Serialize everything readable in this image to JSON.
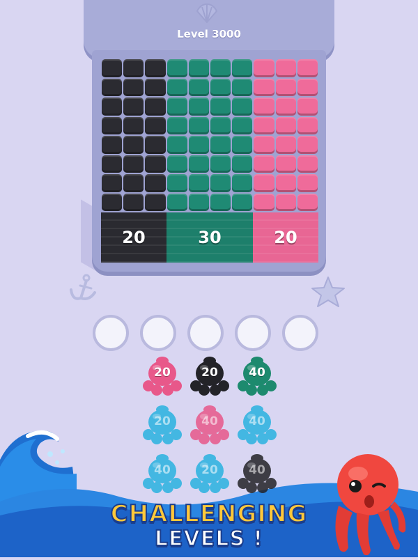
{
  "header": {
    "level_label": "Level 3000"
  },
  "board": {
    "columns": [
      {
        "color": "#2b2b31",
        "count": 3,
        "label": "20"
      },
      {
        "color": "#1f8a74",
        "count": 4,
        "label": "30"
      },
      {
        "color": "#ef6b9a",
        "count": 3,
        "label": "20"
      }
    ],
    "rows": 8
  },
  "slots": {
    "count": 5
  },
  "octopuses": [
    {
      "color": "#e8588a",
      "label": "20",
      "faded": false
    },
    {
      "color": "#232328",
      "label": "20",
      "faded": false
    },
    {
      "color": "#1d8a6e",
      "label": "40",
      "faded": false
    },
    {
      "color": "#2ab2e0",
      "label": "20",
      "faded": true
    },
    {
      "color": "#e8588a",
      "label": "40",
      "faded": true
    },
    {
      "color": "#2ab2e0",
      "label": "40",
      "faded": true
    },
    {
      "color": "#2ab2e0",
      "label": "40",
      "faded": true
    },
    {
      "color": "#2ab2e0",
      "label": "20",
      "faded": true
    },
    {
      "color": "#232328",
      "label": "40",
      "faded": true
    }
  ],
  "banner": {
    "line1": "CHALLENGING",
    "line2": "LEVELS !"
  },
  "icons": {
    "decor_left": "anchor-icon",
    "decor_right": "starfish-icon",
    "top": "shell-icon",
    "mascot": "octopus-mascot-icon",
    "wave": "wave-icon"
  }
}
